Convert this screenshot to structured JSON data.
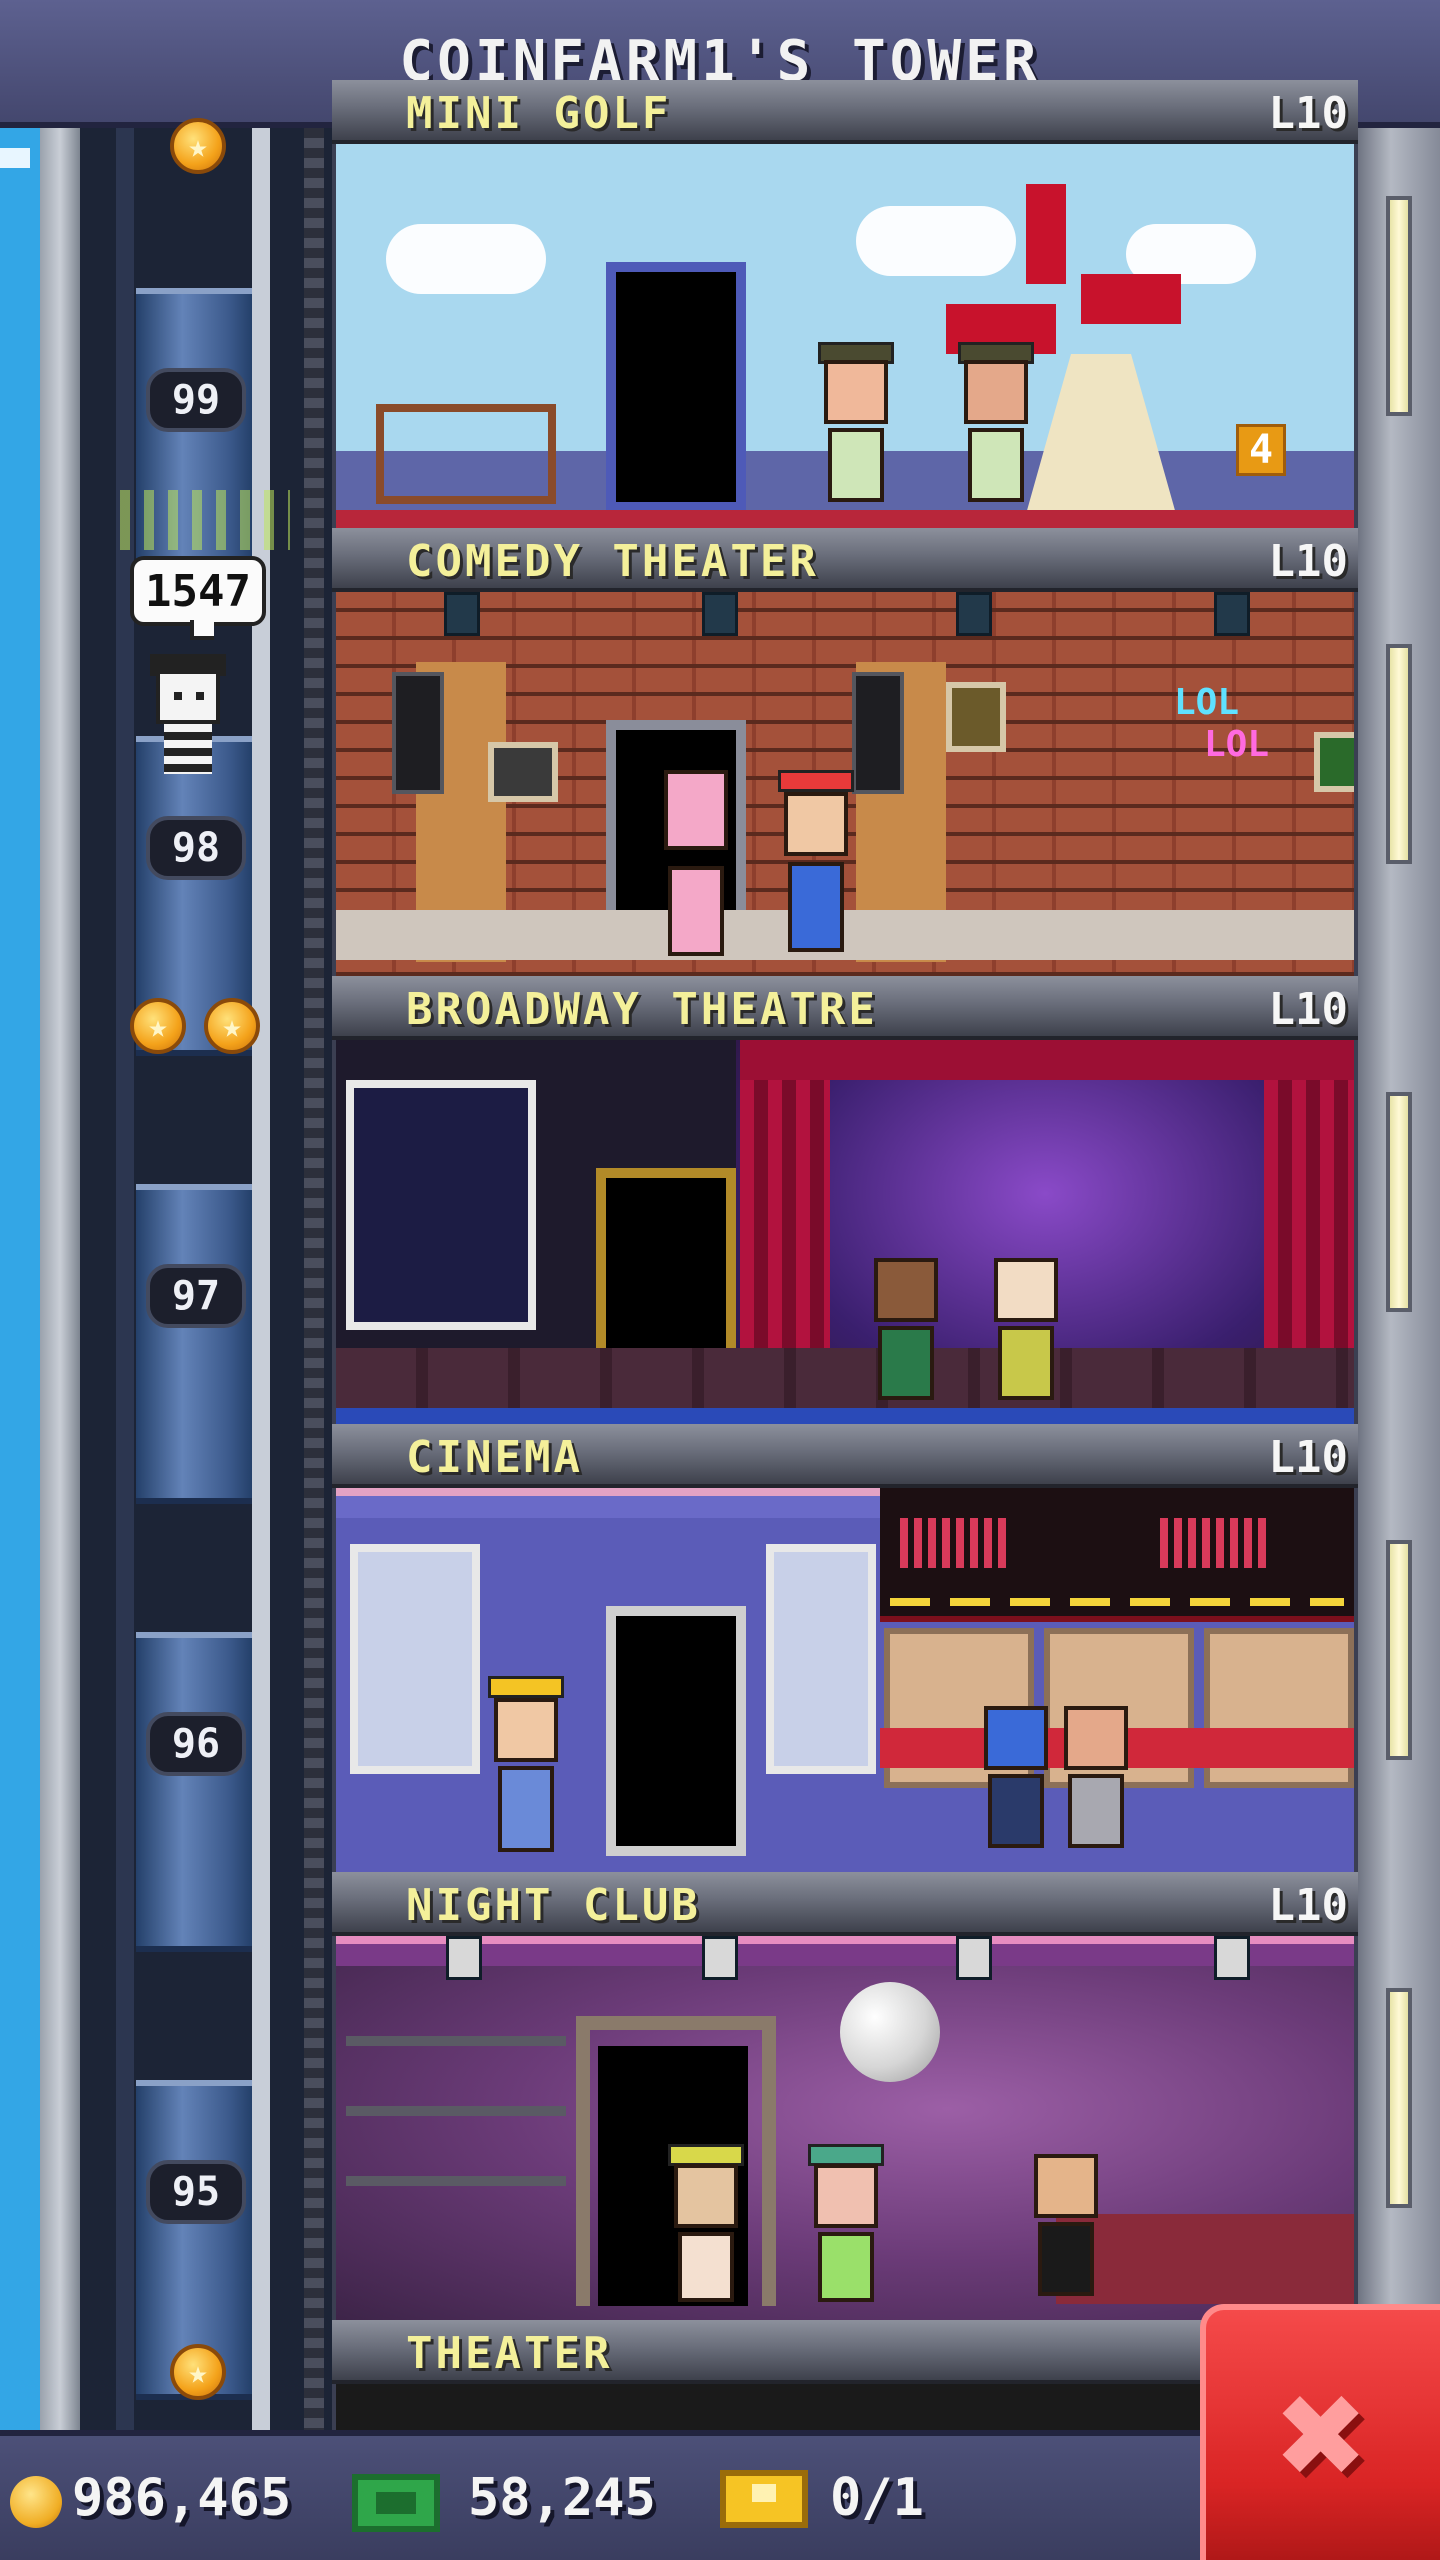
{
  "title": "COINFARM1'S TOWER",
  "elevator": {
    "floor_badges": [
      "99",
      "98",
      "97",
      "96",
      "95"
    ],
    "bitizen_bubble": "1547"
  },
  "floors": [
    {
      "name": "MINI GOLF",
      "level": "L10"
    },
    {
      "name": "COMEDY THEATER",
      "level": "L10"
    },
    {
      "name": "BROADWAY THEATRE",
      "level": "L10"
    },
    {
      "name": "CINEMA",
      "level": "L10"
    },
    {
      "name": "NIGHT CLUB",
      "level": "L10"
    },
    {
      "name": "THEATER",
      "level": ""
    }
  ],
  "decor": {
    "golf_hole": "4",
    "lol_1": "LOL",
    "lol_2": "LOL"
  },
  "stats": {
    "coins": "986,465",
    "bux": "58,245",
    "tickets": "0/1"
  },
  "colors": {
    "accent_gold": "#f4f09a",
    "close_red": "#d92424"
  },
  "icons": {
    "coin": "coin-icon",
    "bux": "bux-icon",
    "ticket": "golden-ticket-icon",
    "close": "close-icon",
    "star": "star-icon"
  }
}
